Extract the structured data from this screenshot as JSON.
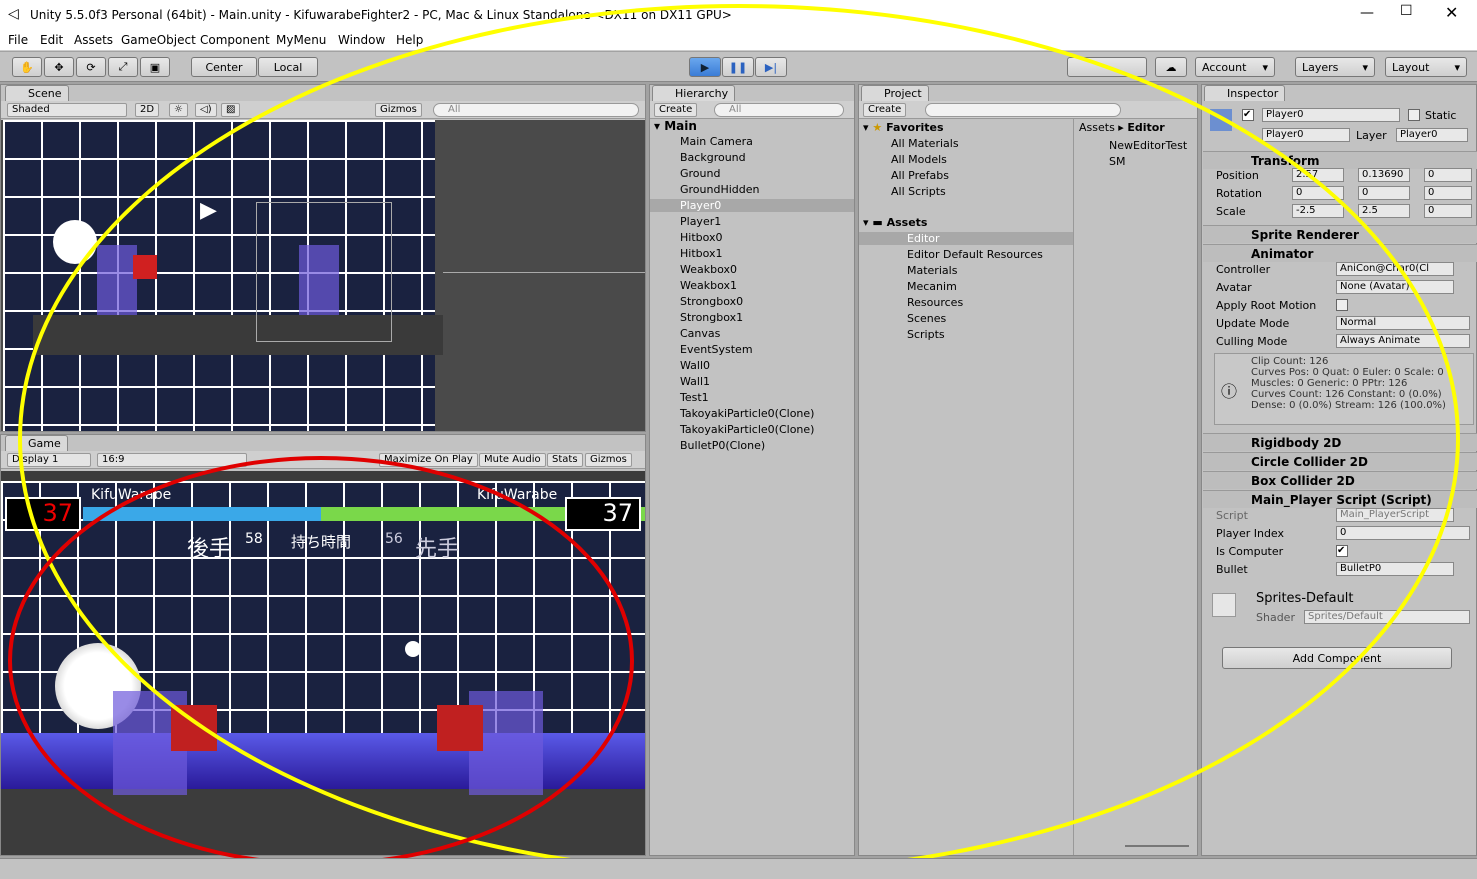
{
  "window": {
    "title": "Unity 5.5.0f3 Personal (64bit) - Main.unity - KifuwarabeFighter2 - PC, Mac & Linux Standalone <DX11 on DX11 GPU>"
  },
  "menu": [
    "File",
    "Edit",
    "Assets",
    "GameObject",
    "Component",
    "MyMenu",
    "Window",
    "Help"
  ],
  "toolbar": {
    "center": "Center",
    "local": "Local",
    "account": "Account",
    "layers": "Layers",
    "layout": "Layout"
  },
  "scene": {
    "tab": "Scene",
    "shading": "Shaded",
    "mode2d": "2D",
    "gizmos": "Gizmos",
    "search": "All"
  },
  "game": {
    "tab": "Game",
    "display": "Display 1",
    "aspect": "16:9",
    "maximize": "Maximize On Play",
    "mute": "Mute Audio",
    "stats": "Stats",
    "gizmos": "Gizmos",
    "p1": {
      "name": "KifuWarabe",
      "hp": "37",
      "time": "58",
      "turn": "後手"
    },
    "p2": {
      "name": "KifuWarabe",
      "hp": "37",
      "time": "56",
      "turn": "先手"
    },
    "timer_label": "持ち時間"
  },
  "hierarchy": {
    "tab": "Hierarchy",
    "create": "Create",
    "search": "All",
    "scene": "Main",
    "items": [
      "Main Camera",
      "Background",
      "Ground",
      "GroundHidden",
      "Player0",
      "Player1",
      "Hitbox0",
      "Hitbox1",
      "Weakbox0",
      "Weakbox1",
      "Strongbox0",
      "Strongbox1",
      "Canvas",
      "EventSystem",
      "Wall0",
      "Wall1",
      "Test1",
      "TakoyakiParticle0(Clone)",
      "TakoyakiParticle0(Clone)",
      "BulletP0(Clone)"
    ]
  },
  "project": {
    "tab": "Project",
    "create": "Create",
    "favorites": "Favorites",
    "fav_items": [
      "All Materials",
      "All Models",
      "All Prefabs",
      "All Scripts"
    ],
    "assets": "Assets",
    "asset_items": [
      "Editor",
      "Editor Default Resources",
      "Materials",
      "Mecanim",
      "Resources",
      "Scenes",
      "Scripts"
    ],
    "breadcrumb_root": "Assets",
    "breadcrumb_leaf": "Editor",
    "files": [
      "NewEditorTest",
      "SM"
    ]
  },
  "inspector": {
    "tab": "Inspector",
    "object_name": "Player0",
    "static": "Static",
    "tag": "Player0",
    "layer_label": "Layer",
    "layer": "Player0",
    "transform": "Transform",
    "position": "Position",
    "rotation": "Rotation",
    "scale": "Scale",
    "pos": {
      "x": "2.57",
      "y": "0.13690",
      "z": "0"
    },
    "rot": {
      "x": "0",
      "y": "0",
      "z": "0"
    },
    "scl": {
      "x": "-2.5",
      "y": "2.5",
      "z": "0"
    },
    "sprite_renderer": "Sprite Renderer",
    "animator": "Animator",
    "controller_label": "Controller",
    "controller": "AniCon@Char0(Cl",
    "avatar_label": "Avatar",
    "avatar": "None (Avatar)",
    "apply_root": "Apply Root Motion",
    "update_mode_label": "Update Mode",
    "update_mode": "Normal",
    "culling_label": "Culling Mode",
    "culling": "Always Animate",
    "info": [
      "Clip Count: 126",
      "Curves Pos: 0 Quat: 0 Euler: 0 Scale: 0",
      "Muscles: 0 Generic: 0 PPtr: 126",
      "Curves Count: 126 Constant: 0 (0.0%)",
      "Dense: 0 (0.0%) Stream: 126 (100.0%)"
    ],
    "rigidbody": "Rigidbody 2D",
    "circle": "Circle Collider 2D",
    "box": "Box Collider 2D",
    "script_comp": "Main_Player Script (Script)",
    "script_label": "Script",
    "script": "Main_PlayerScript",
    "player_index_label": "Player Index",
    "player_index": "0",
    "is_computer": "Is Computer",
    "bullet_label": "Bullet",
    "bullet": "BulletP0",
    "material": "Sprites-Default",
    "shader_label": "Shader",
    "shader": "Sprites/Default",
    "add_component": "Add Component"
  },
  "colors": {
    "highlight_yellow": "#ffff00",
    "highlight_red": "#e00000",
    "play_blue": "#3a7cd6"
  }
}
